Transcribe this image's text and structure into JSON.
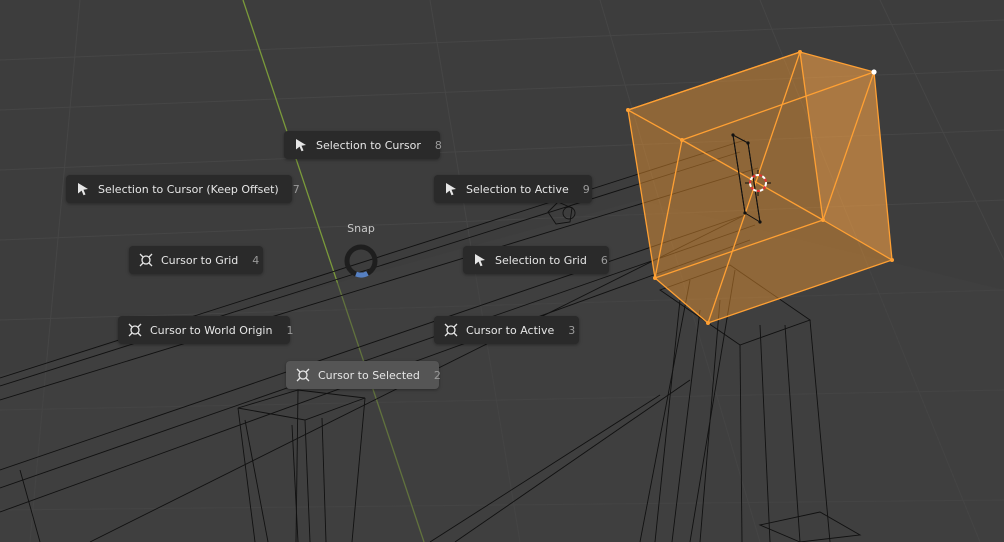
{
  "pie_menu": {
    "title": "Snap",
    "items": [
      {
        "label": "Selection to Cursor",
        "key": "8",
        "icon": "cursor-arrow-icon"
      },
      {
        "label": "Selection to Cursor (Keep Offset)",
        "key": "7",
        "icon": "cursor-arrow-icon"
      },
      {
        "label": "Selection to Active",
        "key": "9",
        "icon": "cursor-arrow-icon"
      },
      {
        "label": "Cursor to Grid",
        "key": "4",
        "icon": "3d-cursor-icon"
      },
      {
        "label": "Selection to Grid",
        "key": "6",
        "icon": "cursor-arrow-icon"
      },
      {
        "label": "Cursor to World Origin",
        "key": "1",
        "icon": "3d-cursor-icon"
      },
      {
        "label": "Cursor to Active",
        "key": "3",
        "icon": "3d-cursor-icon"
      },
      {
        "label": "Cursor to Selected",
        "key": "2",
        "icon": "3d-cursor-icon"
      }
    ],
    "highlighted_item": "Cursor to Selected"
  },
  "colors": {
    "viewport_background": "#3d3d3d",
    "menu_item_background": "#2a2a2a",
    "menu_item_highlight": "#555555",
    "selection_orange": "#ffa033",
    "y_axis_green": "#7a9a3a",
    "wireframe": "#000000",
    "pie_direction_blue": "#5680c2"
  }
}
